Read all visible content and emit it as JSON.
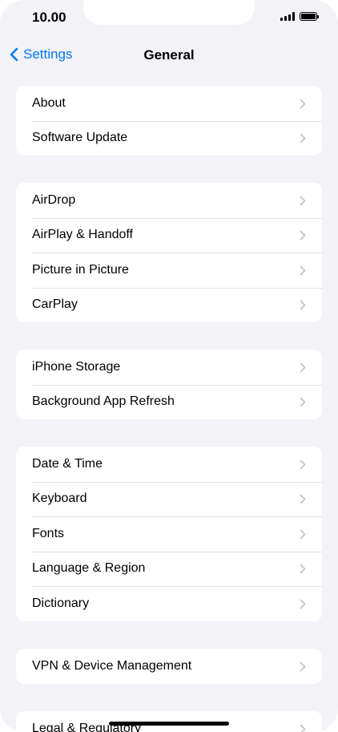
{
  "status": {
    "time": "10.00"
  },
  "nav": {
    "back_label": "Settings",
    "title": "General"
  },
  "groups": [
    [
      "About",
      "Software Update"
    ],
    [
      "AirDrop",
      "AirPlay & Handoff",
      "Picture in Picture",
      "CarPlay"
    ],
    [
      "iPhone Storage",
      "Background App Refresh"
    ],
    [
      "Date & Time",
      "Keyboard",
      "Fonts",
      "Language & Region",
      "Dictionary"
    ],
    [
      "VPN & Device Management"
    ],
    [
      "Legal & Regulatory"
    ]
  ],
  "icons": {
    "back": "chevron-left-icon",
    "row": "chevron-right-icon",
    "signal": "signal-icon",
    "battery": "battery-icon"
  },
  "colors": {
    "accent": "#007aff",
    "background": "#f2f2f7",
    "chevron": "#c4c4c7"
  }
}
